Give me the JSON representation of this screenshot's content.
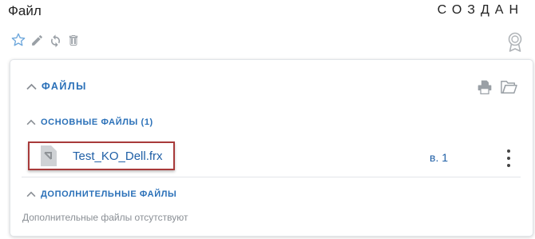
{
  "header": {
    "title": "Файл",
    "status": "СОЗДАН"
  },
  "toolbar": {
    "icons": [
      "star-icon",
      "pencil-icon",
      "refresh-icon",
      "trash-icon"
    ],
    "right_icon": "award-icon"
  },
  "card": {
    "files_section": {
      "label": "Файлы",
      "actions": [
        "print-icon",
        "folder-open-icon"
      ]
    },
    "main_files": {
      "label": "Основные файлы (1)",
      "items": [
        {
          "name": "Test_KO_Dell.frx",
          "version": "в. 1",
          "icon": "document-icon",
          "menu_icon": "kebab-menu-icon"
        }
      ]
    },
    "extra_files": {
      "label": "Дополнительные файлы",
      "empty_text": "Дополнительные файлы отсутствуют"
    }
  },
  "colors": {
    "accent": "#2a70b8",
    "link": "#1f5fa6",
    "highlight_border": "#a83a3a",
    "muted_text": "#8a8f95",
    "icon_gray": "#9aa0a6"
  }
}
